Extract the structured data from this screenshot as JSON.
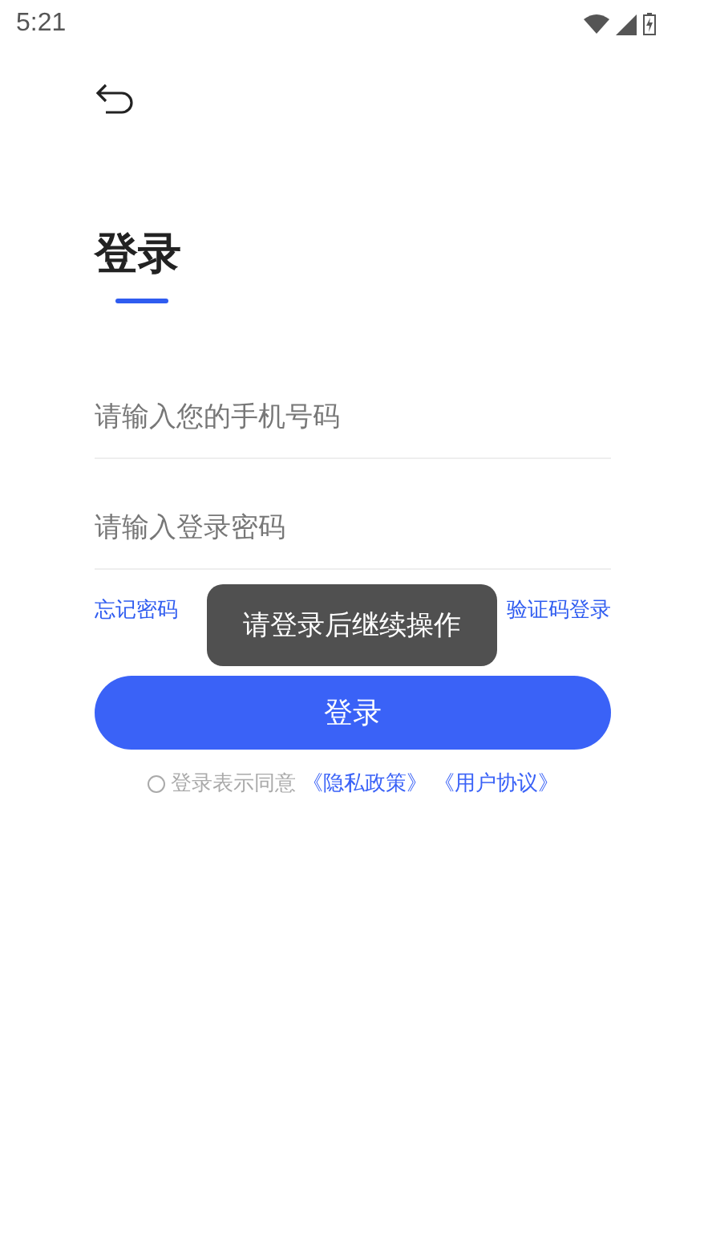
{
  "status_bar": {
    "time": "5:21"
  },
  "title": "登录",
  "fields": [
    {
      "placeholder": "请输入您的手机号码"
    },
    {
      "placeholder": "请输入登录密码"
    }
  ],
  "links": {
    "forgot": "忘记密码",
    "sms": "验证码登录"
  },
  "login_button": "登录",
  "agreement": {
    "checked": false,
    "text": "登录表示同意",
    "privacy": "《隐私政策》",
    "terms": "《用户协议》"
  },
  "toast": "请登录后继续操作"
}
